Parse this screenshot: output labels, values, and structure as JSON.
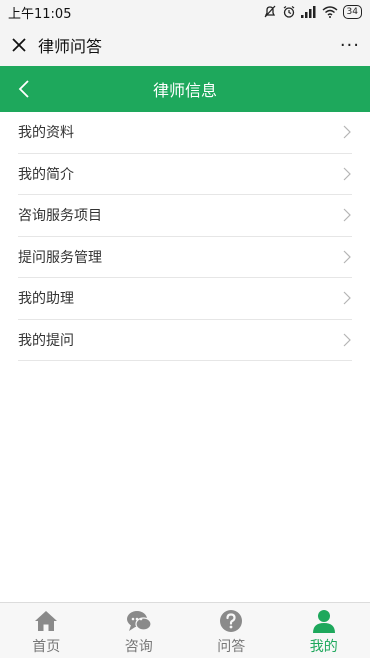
{
  "status_bar": {
    "time": "上午11:05",
    "battery": "34"
  },
  "app_bar": {
    "title": "律师问答",
    "more": "···"
  },
  "nav_bar": {
    "title": "律师信息"
  },
  "menu": {
    "items": [
      {
        "label": "我的资料"
      },
      {
        "label": "我的简介"
      },
      {
        "label": "咨询服务项目"
      },
      {
        "label": "提问服务管理"
      },
      {
        "label": "我的助理"
      },
      {
        "label": "我的提问"
      }
    ]
  },
  "tab_bar": {
    "tabs": [
      {
        "label": "首页",
        "icon": "home-icon"
      },
      {
        "label": "咨询",
        "icon": "chat-icon"
      },
      {
        "label": "问答",
        "icon": "question-icon"
      },
      {
        "label": "我的",
        "icon": "user-icon"
      }
    ],
    "active_color": "#1ea85c",
    "inactive_color": "#777777"
  },
  "colors": {
    "brand": "#1ea85c"
  }
}
